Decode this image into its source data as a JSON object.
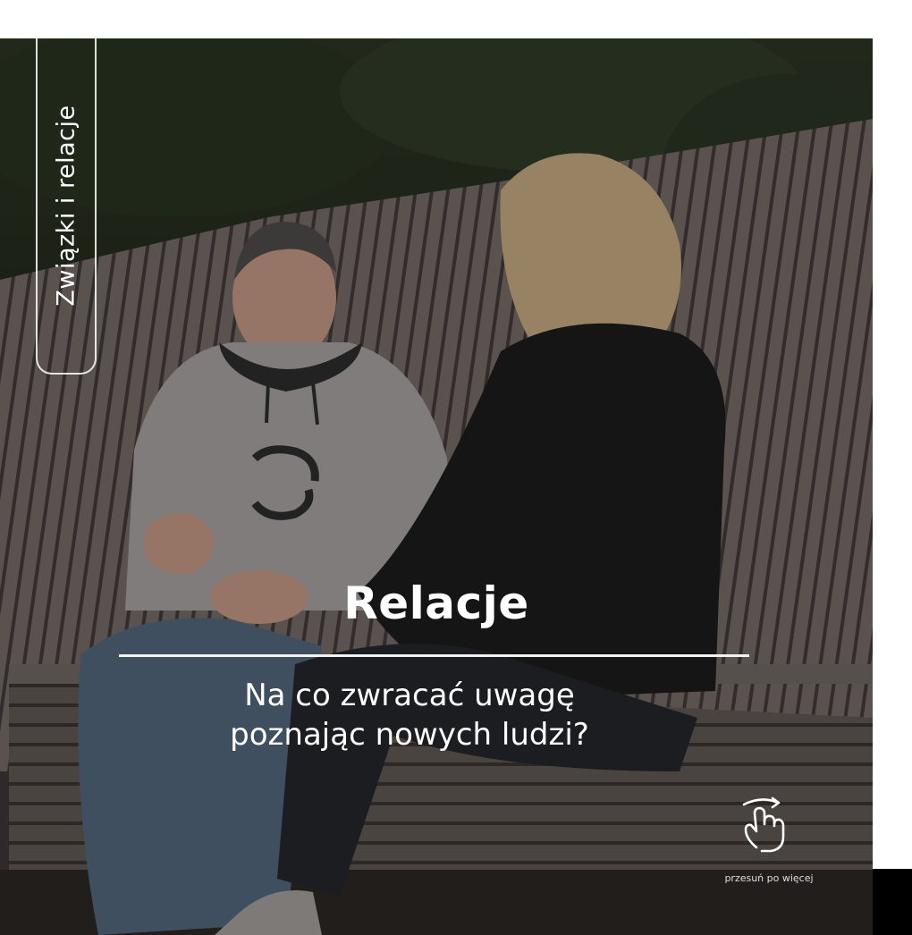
{
  "post": {
    "category_tag": "Związki i relacje",
    "headline": "Relacje",
    "subheadline_line1": "Na co zwracać uwagę",
    "subheadline_line2": "poznając nowych ludzi?",
    "swipe_hint": "przesuń po więcej",
    "swipe_icon": "swipe-hand-icon"
  },
  "colors": {
    "text": "#ffffff",
    "divider": "#f2f2f2",
    "bottom_bar": "#000000",
    "page_background": "#ffffff"
  }
}
